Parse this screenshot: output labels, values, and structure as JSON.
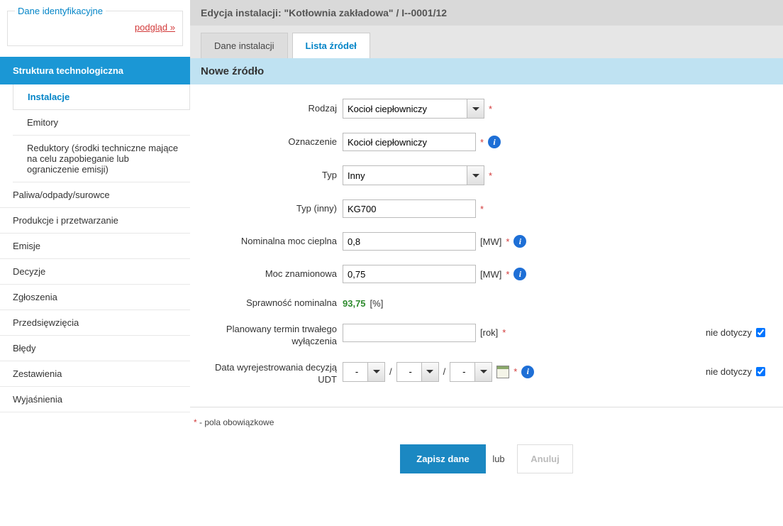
{
  "sidebar": {
    "ident_title": "Dane identyfikacyjne",
    "preview": "podgląd »",
    "active": "Struktura technologiczna",
    "sub": [
      {
        "label": "Instalacje",
        "sel": true
      },
      {
        "label": "Emitory"
      },
      {
        "label": "Reduktory (środki techniczne mające na celu zapobieganie lub ograniczenie emisji)"
      }
    ],
    "items": [
      "Paliwa/odpady/surowce",
      "Produkcje i przetwarzanie",
      "Emisje",
      "Decyzje",
      "Zgłoszenia",
      "Przedsięwzięcia",
      "Błędy",
      "Zestawienia",
      "Wyjaśnienia"
    ]
  },
  "header": "Edycja instalacji: \"Kotłownia zakładowa\" / I--0001/12",
  "tabs": {
    "a": "Dane instalacji",
    "b": "Lista źródeł"
  },
  "section": "Nowe źródło",
  "form": {
    "rodzaj_lbl": "Rodzaj",
    "rodzaj_val": "Kocioł ciepłowniczy",
    "ozn_lbl": "Oznaczenie",
    "ozn_val": "Kocioł ciepłowniczy",
    "typ_lbl": "Typ",
    "typ_val": "Inny",
    "typinny_lbl": "Typ (inny)",
    "typinny_val": "KG700",
    "nom_lbl": "Nominalna moc cieplna",
    "nom_val": "0,8",
    "mw": "[MW]",
    "mzn_lbl": "Moc znamionowa",
    "mzn_val": "0,75",
    "spr_lbl": "Sprawność nominalna",
    "spr_val": "93,75",
    "pct": "[%]",
    "plan_lbl": "Planowany termin trwałego wyłączenia",
    "rok": "[rok]",
    "nd": "nie dotyczy",
    "data_lbl": "Data wyrejestrowania decyzją UDT",
    "dash": "-",
    "slash": "/"
  },
  "foot": {
    "req": "* - pola obowiązkowe",
    "save": "Zapisz dane",
    "or": "lub",
    "cancel": "Anuluj"
  }
}
